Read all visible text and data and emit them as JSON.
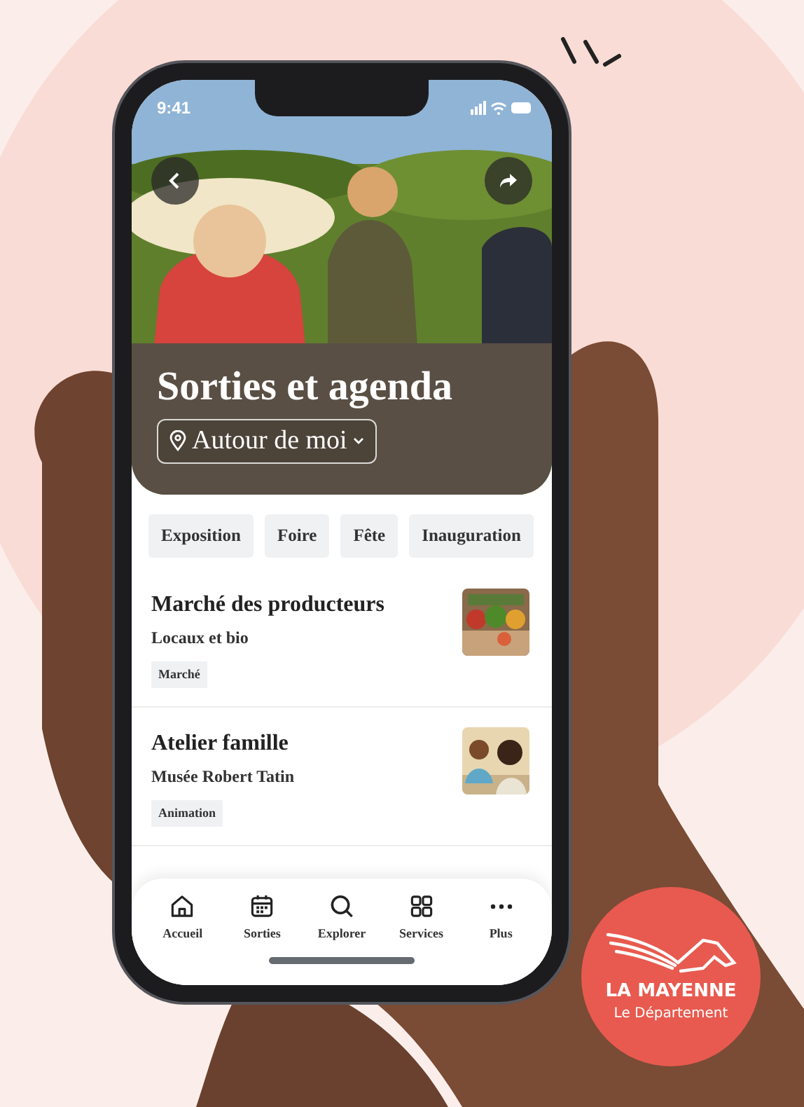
{
  "status_bar": {
    "time": "9:41"
  },
  "header": {
    "title": "Sorties et agenda",
    "location_button": "Autour de moi"
  },
  "chips": [
    {
      "label": "Exposition"
    },
    {
      "label": "Foire"
    },
    {
      "label": "Fête"
    },
    {
      "label": "Inauguration"
    }
  ],
  "events": [
    {
      "title": "Marché des producteurs",
      "subtitle": "Locaux et bio",
      "tag": "Marché"
    },
    {
      "title": "Atelier famille",
      "subtitle": "Musée Robert Tatin",
      "tag": "Animation"
    }
  ],
  "bottom_nav": [
    {
      "label": "Accueil",
      "kind": "home"
    },
    {
      "label": "Sorties",
      "kind": "calendar"
    },
    {
      "label": "Explorer",
      "kind": "search"
    },
    {
      "label": "Services",
      "kind": "grid"
    },
    {
      "label": "Plus",
      "kind": "more"
    }
  ],
  "brand": {
    "name": "LA MAYENNE",
    "subtitle": "Le Département"
  }
}
